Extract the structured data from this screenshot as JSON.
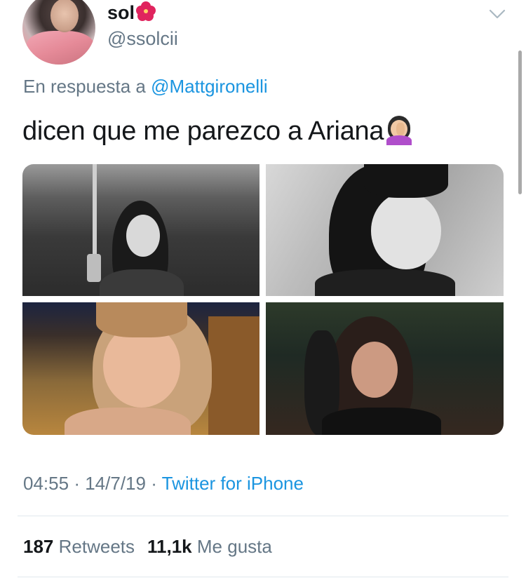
{
  "author": {
    "name": "sol",
    "name_emoji": "hibiscus-emoji",
    "handle": "@ssolcii"
  },
  "reply": {
    "prefix": "En respuesta a",
    "mention": "@Mattgironelli"
  },
  "tweet": {
    "text": "dicen que me parezco a Ariana",
    "text_emoji": "woman-facepalming-emoji"
  },
  "meta": {
    "time": "04:55",
    "separator1": "·",
    "date": "14/7/19",
    "separator2": "·",
    "source": "Twitter for iPhone"
  },
  "stats": {
    "retweets_count": "187",
    "retweets_label": "Retweets",
    "likes_count": "11,1k",
    "likes_label": "Me gusta"
  },
  "icons": {
    "menu": "chevron-down-icon"
  },
  "colors": {
    "link": "#1b95e0",
    "secondary": "#657786",
    "primary": "#14171a",
    "divider": "#e1e8ed"
  }
}
